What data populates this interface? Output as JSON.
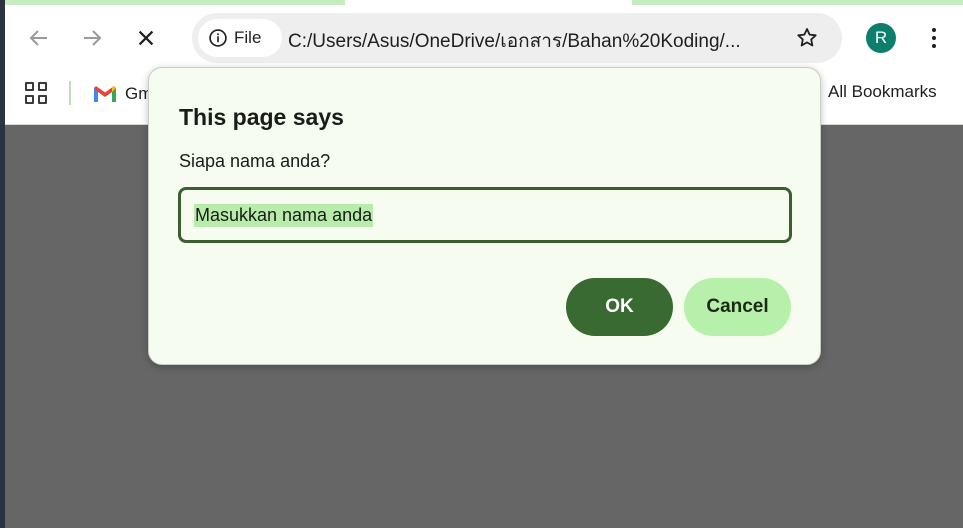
{
  "browser": {
    "site_chip_label": "File",
    "url": "C:/Users/Asus/OneDrive/เอกสาร/Bahan%20Koding/...",
    "avatar_letter": "R",
    "accent_color": "#c7ecc0",
    "icons": {
      "back": "arrow-left-icon",
      "forward": "arrow-right-icon",
      "stop": "close-icon",
      "site_info": "info-icon",
      "bookmark": "star-icon",
      "menu": "more-vertical-icon",
      "apps": "apps-grid-icon",
      "gmail": "gmail-icon"
    }
  },
  "bookmarks": {
    "gmail_label": "Gm",
    "all_label": "All Bookmarks"
  },
  "dialog": {
    "title": "This page says",
    "message": "Siapa nama anda?",
    "input_value": "Masukkan nama anda",
    "ok_label": "OK",
    "cancel_label": "Cancel",
    "colors": {
      "background": "#f7fcf1",
      "primary": "#386a31",
      "secondary": "#b7f0ab",
      "selection": "#b7ecab"
    }
  },
  "page": {
    "backdrop_color": "#666666"
  }
}
